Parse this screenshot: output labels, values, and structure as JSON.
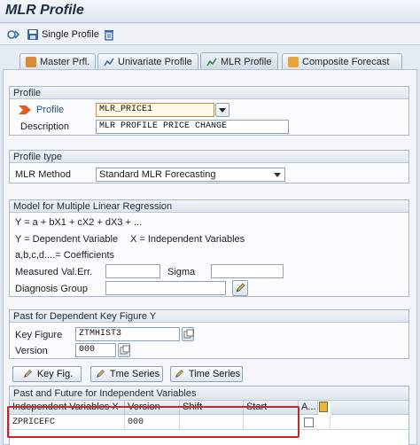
{
  "window": {
    "title": "MLR Profile"
  },
  "toolbar": {
    "single_profile": "Single Profile"
  },
  "tabs": [
    {
      "label": "Master Prfl."
    },
    {
      "label": "Univariate Profile"
    },
    {
      "label": "MLR Profile"
    },
    {
      "label": "Composite Forecast"
    }
  ],
  "profile": {
    "group_title": "Profile",
    "profile_label": "Profile",
    "profile_value": "MLR_PRICE1",
    "description_label": "Description",
    "description_value": "MLR PROFILE PRICE CHANGE"
  },
  "profile_type": {
    "group_title": "Profile type",
    "method_label": "MLR Method",
    "method_value": "Standard MLR Forecasting"
  },
  "model": {
    "group_title": "Model for Multiple Linear Regression",
    "formula": "Y = a + bX1 + cX2 + dX3 + ...",
    "dep_var": "Y = Dependent Variable",
    "indep_var": "X = Independent Variables",
    "coefficients": "a,b,c,d....= Coefficients",
    "measured_label": "Measured Val.Err.",
    "measured_value": "",
    "sigma_label": "Sigma",
    "sigma_value": "",
    "diagnosis_label": "Diagnosis Group",
    "diagnosis_value": ""
  },
  "past": {
    "group_title": "Past for Dependent Key Figure Y",
    "keyfig_label": "Key Figure",
    "keyfig_value": "ZTMHIST3",
    "version_label": "Version",
    "version_value": "000"
  },
  "buttons": {
    "key_fig": "Key Fig.",
    "tme_series": "Tme Series",
    "time_series": "Time Series"
  },
  "indep_table": {
    "title": "Past and Future for Independent Variables",
    "columns": [
      "Independent Variables X",
      "Version",
      "Shift",
      "Start",
      "A..."
    ],
    "rows": [
      {
        "variable": "ZPRICEFC",
        "version": "000",
        "shift": "",
        "start": ""
      }
    ]
  },
  "colors": {
    "highlight": "#c22a2a",
    "accent": "#e8a33a",
    "profile_arrow": "#e25b1a"
  }
}
